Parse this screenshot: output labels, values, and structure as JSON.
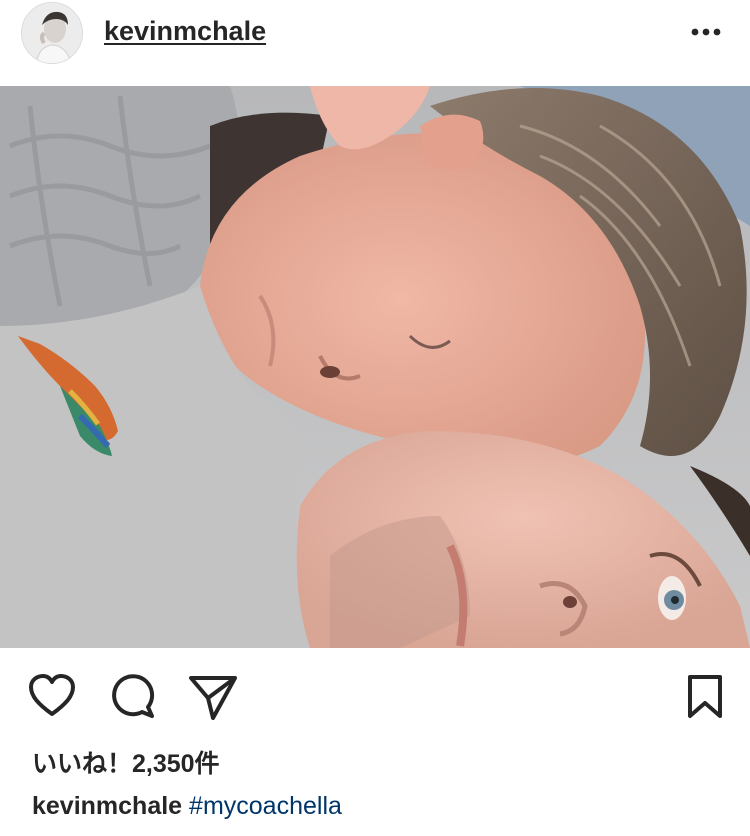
{
  "post": {
    "username": "kevinmchale",
    "more_icon": "more-horizontal-icon",
    "photo_alt": "post photo",
    "actions": {
      "like_icon": "heart-icon",
      "comment_icon": "comment-icon",
      "share_icon": "paper-plane-icon",
      "save_icon": "bookmark-icon"
    },
    "likes_text": "いいね！2,350件",
    "caption": {
      "username": "kevinmchale",
      "hashtag": "#mycoachella"
    }
  },
  "colors": {
    "text": "#262626",
    "hashtag": "#003569",
    "background": "#ffffff"
  }
}
